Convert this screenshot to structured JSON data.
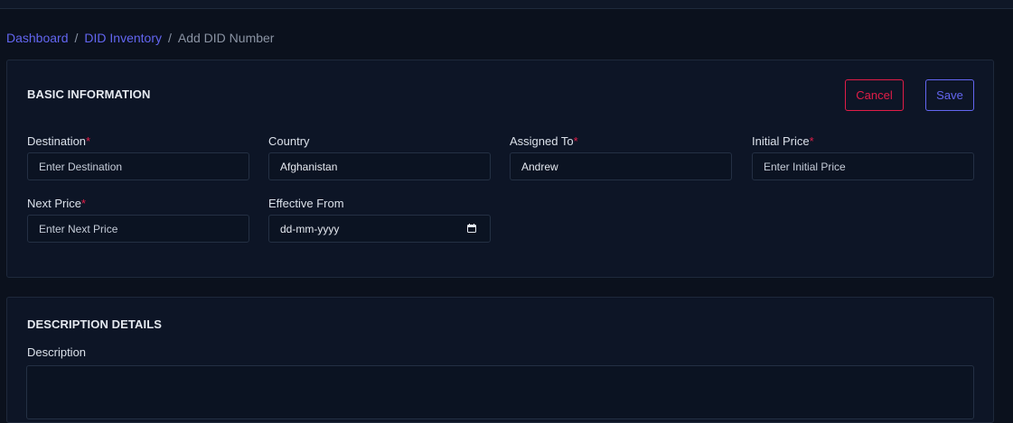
{
  "breadcrumb": {
    "items": [
      "Dashboard",
      "DID Inventory"
    ],
    "separator": "/",
    "current": "Add DID Number"
  },
  "basic_info": {
    "title": "BASIC INFORMATION",
    "cancel_label": "Cancel",
    "save_label": "Save",
    "required_marker": "*",
    "fields": {
      "destination": {
        "label": "Destination",
        "placeholder": "Enter Destination",
        "value": ""
      },
      "country": {
        "label": "Country",
        "value": "Afghanistan"
      },
      "assigned_to": {
        "label": "Assigned To",
        "value": "Andrew"
      },
      "initial_price": {
        "label": "Initial Price",
        "placeholder": "Enter Initial Price",
        "value": ""
      },
      "next_price": {
        "label": "Next Price",
        "placeholder": "Enter Next Price",
        "value": ""
      },
      "effective_from": {
        "label": "Effective From",
        "placeholder": "dd-mm-yyyy",
        "value": "dd-mm-yyyy"
      }
    }
  },
  "description": {
    "title": "DESCRIPTION DETAILS",
    "label": "Description",
    "value": ""
  },
  "colors": {
    "background": "#0b111d",
    "card": "#0d1526",
    "accent": "#6366f1",
    "danger": "#e11d48"
  },
  "icons": {
    "date_picker": "calendar-icon"
  }
}
